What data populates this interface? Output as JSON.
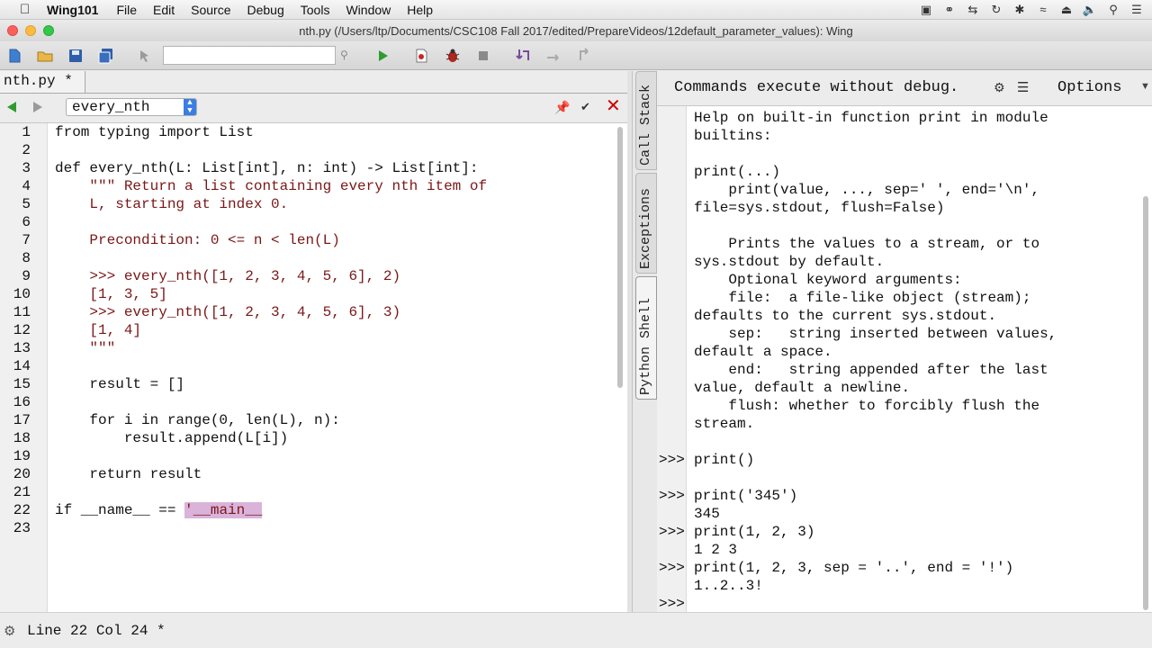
{
  "menubar": {
    "app_name": "Wing101",
    "items": [
      "File",
      "Edit",
      "Source",
      "Debug",
      "Tools",
      "Window",
      "Help"
    ]
  },
  "window": {
    "title": "nth.py (/Users/ltp/Documents/CSC108 Fall 2017/edited/PrepareVideos/12default_parameter_values): Wing"
  },
  "editor": {
    "tab_label": "nth.py *",
    "scope": "every_nth",
    "line_numbers": [
      "1",
      "2",
      "3",
      "4",
      "5",
      "6",
      "7",
      "8",
      "9",
      "10",
      "11",
      "12",
      "13",
      "14",
      "15",
      "16",
      "17",
      "18",
      "19",
      "20",
      "21",
      "22",
      "23"
    ],
    "lines": [
      "from typing import List",
      "",
      "def every_nth(L: List[int], n: int) -> List[int]:",
      "    \"\"\" Return a list containing every nth item of",
      "    L, starting at index 0.",
      "",
      "    Precondition: 0 <= n < len(L)",
      "",
      "    >>> every_nth([1, 2, 3, 4, 5, 6], 2)",
      "    [1, 3, 5]",
      "    >>> every_nth([1, 2, 3, 4, 5, 6], 3)",
      "    [1, 4]",
      "    \"\"\"",
      "",
      "    result = []",
      "",
      "    for i in range(0, len(L), n):",
      "        result.append(L[i])",
      "",
      "    return result",
      "",
      "if __name__ == '__main__",
      ""
    ]
  },
  "side_tabs": {
    "call_stack": "Call Stack",
    "exceptions": "Exceptions",
    "python_shell": "Python Shell"
  },
  "shell": {
    "message": "Commands execute without debug.",
    "options_label": "Options",
    "prompt": ">>>",
    "lines": [
      {
        "prompt": "",
        "text": "Help on built-in function print in module"
      },
      {
        "prompt": "",
        "text": "builtins:"
      },
      {
        "prompt": "",
        "text": ""
      },
      {
        "prompt": "",
        "text": "print(...)"
      },
      {
        "prompt": "",
        "text": "    print(value, ..., sep=' ', end='\\n',"
      },
      {
        "prompt": "",
        "text": "file=sys.stdout, flush=False)"
      },
      {
        "prompt": "",
        "text": ""
      },
      {
        "prompt": "",
        "text": "    Prints the values to a stream, or to"
      },
      {
        "prompt": "",
        "text": "sys.stdout by default."
      },
      {
        "prompt": "",
        "text": "    Optional keyword arguments:"
      },
      {
        "prompt": "",
        "text": "    file:  a file-like object (stream);"
      },
      {
        "prompt": "",
        "text": "defaults to the current sys.stdout."
      },
      {
        "prompt": "",
        "text": "    sep:   string inserted between values,"
      },
      {
        "prompt": "",
        "text": "default a space."
      },
      {
        "prompt": "",
        "text": "    end:   string appended after the last"
      },
      {
        "prompt": "",
        "text": "value, default a newline."
      },
      {
        "prompt": "",
        "text": "    flush: whether to forcibly flush the"
      },
      {
        "prompt": "",
        "text": "stream."
      },
      {
        "prompt": "",
        "text": ""
      },
      {
        "prompt": ">>>",
        "text": "print()"
      },
      {
        "prompt": "",
        "text": ""
      },
      {
        "prompt": ">>>",
        "text": "print('345')"
      },
      {
        "prompt": "",
        "text": "345"
      },
      {
        "prompt": ">>>",
        "text": "print(1, 2, 3)"
      },
      {
        "prompt": "",
        "text": "1 2 3"
      },
      {
        "prompt": ">>>",
        "text": "print(1, 2, 3, sep = '..', end = '!')"
      },
      {
        "prompt": "",
        "text": "1..2..3!"
      },
      {
        "prompt": ">>>",
        "text": ""
      }
    ]
  },
  "statusbar": {
    "text": "Line 22 Col 24 *"
  },
  "colors": {
    "keyword": "#111111",
    "function_name": "#0b6b6b",
    "string": "#7a1717",
    "selection": "#dab3db",
    "run_green": "#2e9c2e",
    "close_red": "#cc0000"
  }
}
